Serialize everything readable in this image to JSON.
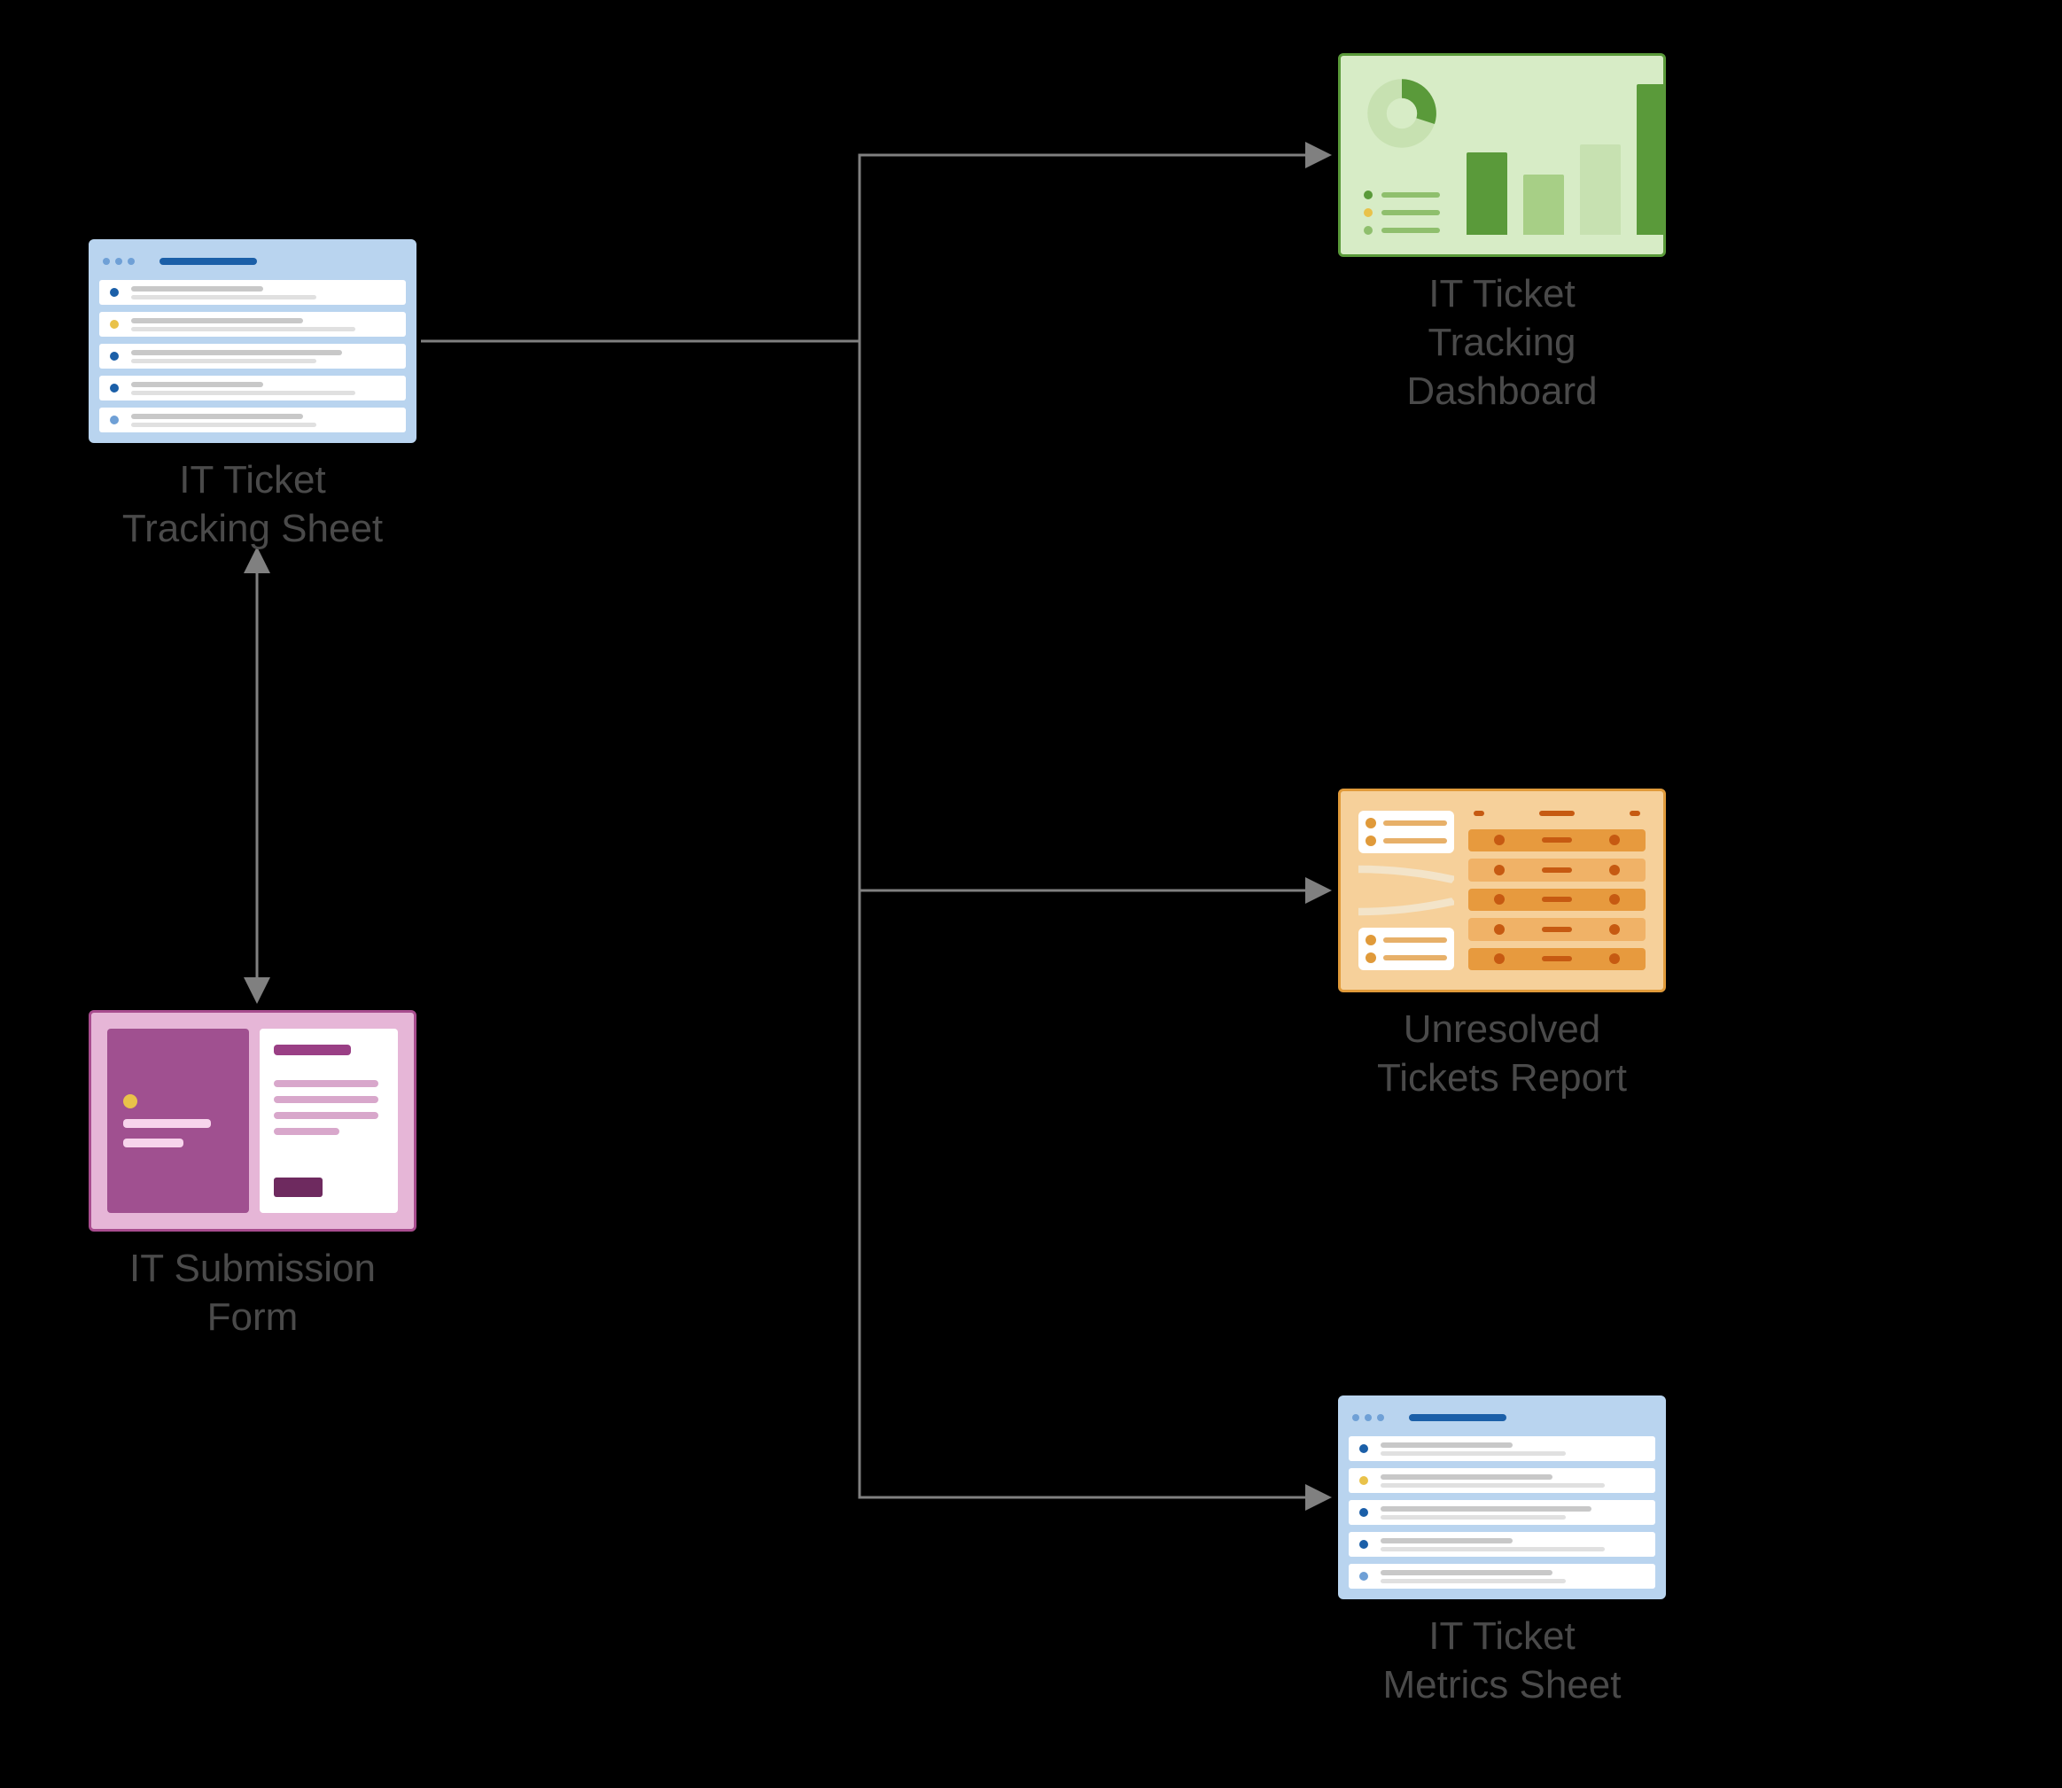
{
  "diagram": {
    "nodes": {
      "tracking_sheet": {
        "label": "IT Ticket\nTracking Sheet",
        "type": "sheet",
        "row_bullet_colors": [
          "#1b5fa8",
          "#e9c24a",
          "#1b5fa8",
          "#1b5fa8",
          "#6fa0d6"
        ]
      },
      "submission_form": {
        "label": "IT Submission\nForm",
        "type": "form"
      },
      "dashboard": {
        "label": "IT Ticket\nTracking\nDashboard",
        "type": "dashboard",
        "bar_heights_pct": [
          55,
          40,
          60,
          100
        ],
        "bar_colors": [
          "#5a9a3a",
          "#a7cf86",
          "#c7e1b1",
          "#5a9a3a"
        ],
        "bullet_colors": [
          "#5a9a3a",
          "#e9c24a",
          "#8fbf6d"
        ]
      },
      "report": {
        "label": "Unresolved\nTickets Report",
        "type": "report"
      },
      "metrics_sheet": {
        "label": "IT Ticket\nMetrics Sheet",
        "type": "sheet",
        "row_bullet_colors": [
          "#1b5fa8",
          "#e9c24a",
          "#1b5fa8",
          "#1b5fa8",
          "#6fa0d6"
        ]
      }
    },
    "edges": [
      {
        "from": "tracking_sheet",
        "to": "submission_form",
        "bidirectional": true
      },
      {
        "from": "tracking_sheet",
        "to": "dashboard",
        "bidirectional": false
      },
      {
        "from": "tracking_sheet",
        "to": "report",
        "bidirectional": false
      },
      {
        "from": "tracking_sheet",
        "to": "metrics_sheet",
        "bidirectional": false
      }
    ]
  }
}
